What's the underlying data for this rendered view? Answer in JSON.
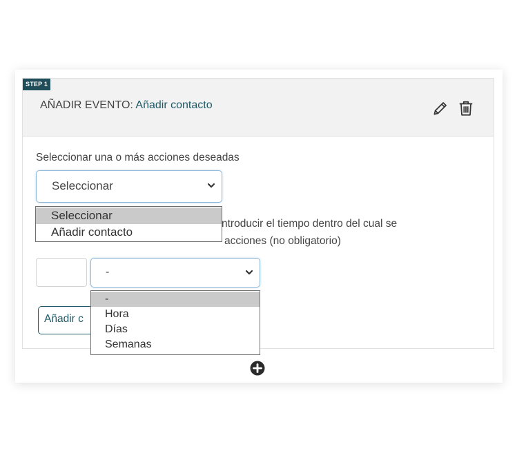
{
  "step": {
    "badge": "STEP 1",
    "title_label": "AÑADIR EVENTO:",
    "title_value": "Añadir contacto"
  },
  "icons": {
    "edit": "pencil-icon",
    "delete": "trash-icon",
    "add_step": "plus-circle-icon",
    "select_chevron": "chevron-down-icon"
  },
  "actions": {
    "label": "Seleccionar una o más acciones deseadas",
    "select_value": "Seleccionar",
    "options": [
      "Seleccionar",
      "Añadir contacto"
    ],
    "selected_option": "Seleccionar"
  },
  "time": {
    "label_line1_visible": "ntroducir el tiempo dentro del cual se",
    "label_line2_visible": "acciones (no obligatorio)",
    "amount_value": "",
    "unit_value": "-",
    "unit_options": [
      "-",
      "Hora",
      "Días",
      "Semanas"
    ],
    "selected_option": "-"
  },
  "add_button": {
    "label_visible": "Añadir c"
  },
  "colors": {
    "accent": "#1f5966",
    "badge": "#1f4e5a",
    "focus_border": "#8db8d9",
    "option_highlight": "#cacaca"
  }
}
